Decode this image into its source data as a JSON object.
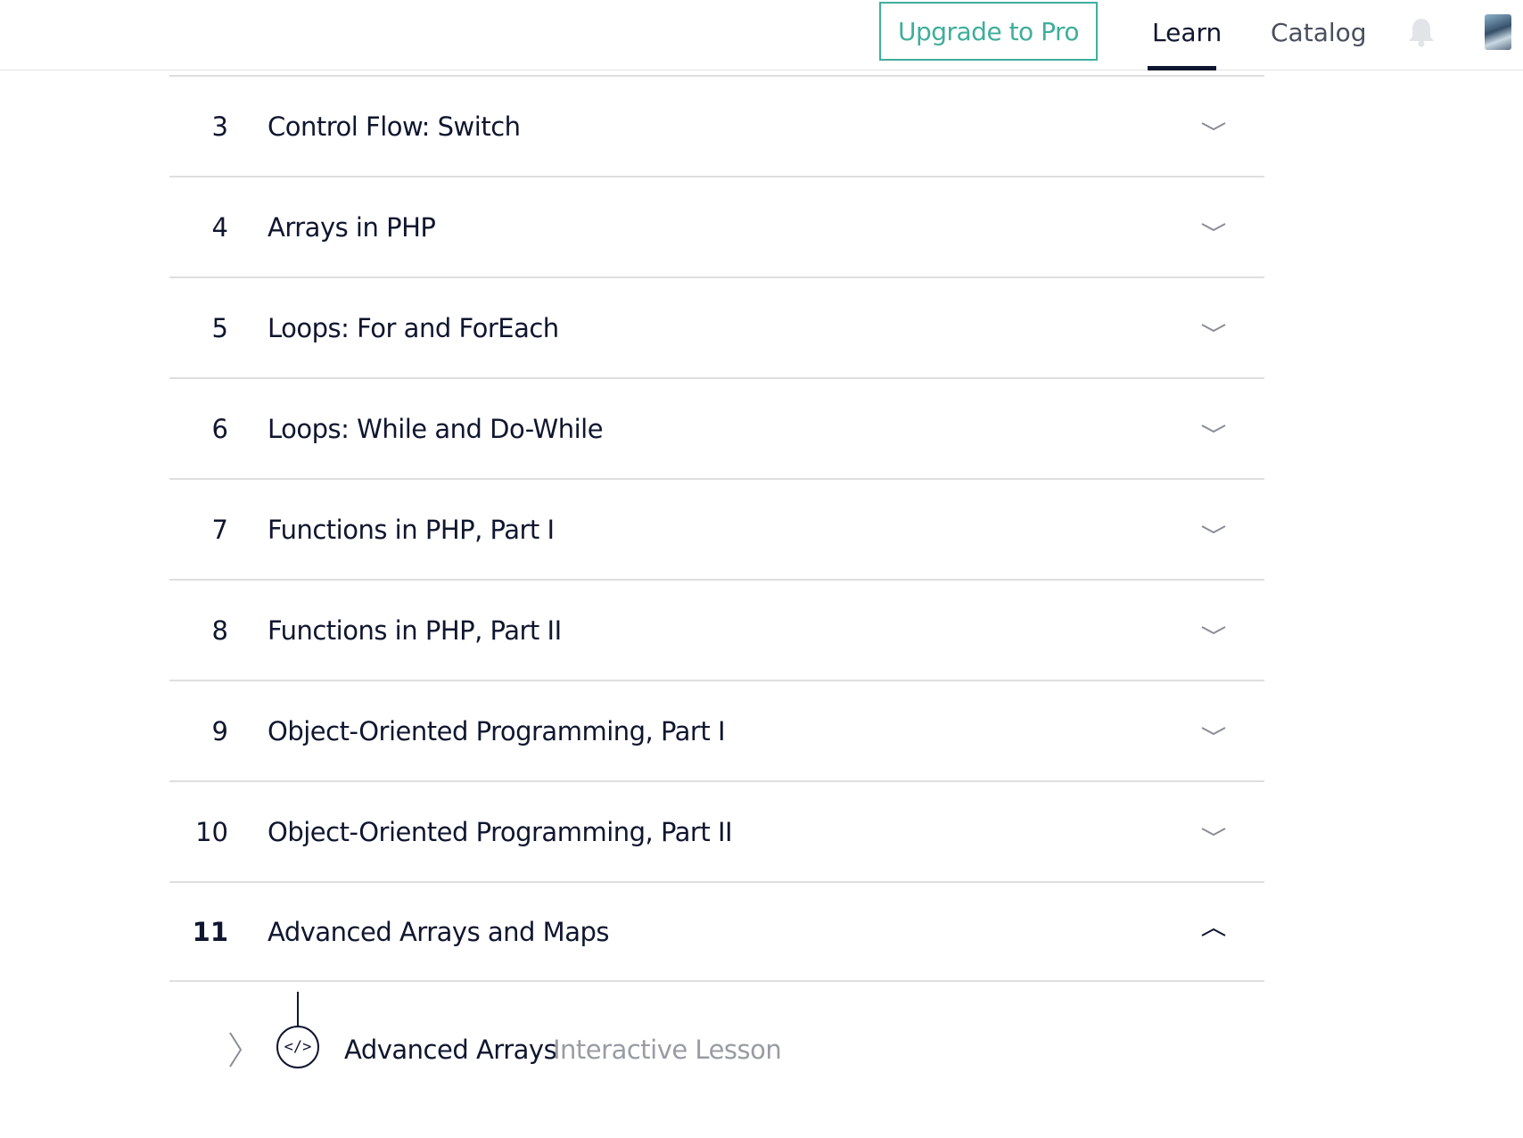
{
  "header": {
    "upgrade_label": "Upgrade to Pro",
    "nav": [
      {
        "label": "Learn",
        "active": true
      },
      {
        "label": "Catalog",
        "active": false
      }
    ],
    "icons": {
      "notifications": "bell-icon",
      "profile": "avatar"
    }
  },
  "modules": [
    {
      "number": "3",
      "title": "Control Flow: Switch",
      "expanded": false
    },
    {
      "number": "4",
      "title": "Arrays in PHP",
      "expanded": false
    },
    {
      "number": "5",
      "title": "Loops: For and ForEach",
      "expanded": false
    },
    {
      "number": "6",
      "title": "Loops: While and Do-While",
      "expanded": false
    },
    {
      "number": "7",
      "title": "Functions in PHP, Part I",
      "expanded": false
    },
    {
      "number": "8",
      "title": "Functions in PHP, Part II",
      "expanded": false
    },
    {
      "number": "9",
      "title": "Object-Oriented Programming, Part I",
      "expanded": false
    },
    {
      "number": "10",
      "title": "Object-Oriented Programming, Part II",
      "expanded": false
    },
    {
      "number": "11",
      "title": "Advanced Arrays and Maps",
      "expanded": true
    }
  ],
  "lesson": {
    "icon_glyph": "</>",
    "title": "Advanced Arrays",
    "type": "Interactive Lesson"
  },
  "colors": {
    "accent": "#3fae9b",
    "text": "#10162f",
    "muted": "#9a9ca3",
    "divider": "#dedede"
  }
}
